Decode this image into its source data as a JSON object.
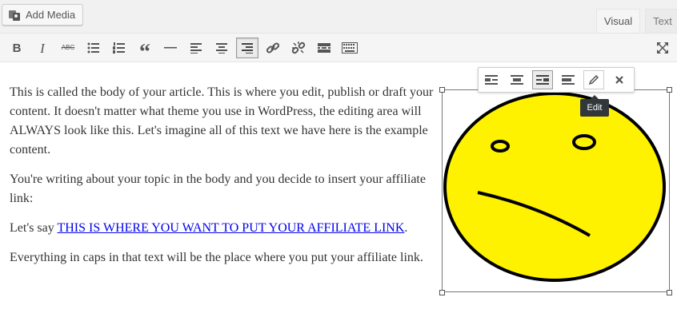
{
  "header": {
    "add_media_label": "Add Media",
    "tabs": [
      {
        "label": "Visual",
        "active": true
      },
      {
        "label": "Text",
        "active": false
      }
    ]
  },
  "toolbar": {
    "buttons": [
      {
        "name": "bold",
        "glyph": "B"
      },
      {
        "name": "italic",
        "glyph": "I"
      },
      {
        "name": "strikethrough",
        "glyph": "ABC"
      },
      {
        "name": "bulleted-list",
        "glyph": ""
      },
      {
        "name": "numbered-list",
        "glyph": ""
      },
      {
        "name": "blockquote",
        "glyph": "“"
      },
      {
        "name": "horizontal-line",
        "glyph": "—"
      },
      {
        "name": "align-left",
        "glyph": ""
      },
      {
        "name": "align-center",
        "glyph": ""
      },
      {
        "name": "align-right",
        "glyph": "",
        "active": true
      },
      {
        "name": "insert-link",
        "glyph": ""
      },
      {
        "name": "remove-link",
        "glyph": ""
      },
      {
        "name": "read-more",
        "glyph": ""
      },
      {
        "name": "toolbar-toggle",
        "glyph": ""
      },
      {
        "name": "fullscreen",
        "glyph": ""
      }
    ]
  },
  "content": {
    "paragraph1": "This is called the body of your article. This is where you edit, publish or draft your content. It doesn't matter what theme you use in WordPress, the editing area will ALWAYS look like this. Let's imagine all of this text we have here is the example content.",
    "paragraph2": "You're writing about your topic in the body and you decide to insert your affiliate link:",
    "paragraph3_prefix": "Let's say ",
    "paragraph3_link": "THIS IS WHERE YOU WANT TO PUT YOUR AFFILIATE LINK",
    "paragraph3_suffix": ".",
    "paragraph4": "Everything in caps in that text will be the place where you put your affiliate link."
  },
  "image_toolbar": {
    "buttons": [
      "align-left",
      "align-center",
      "align-right",
      "align-none",
      "edit",
      "remove"
    ],
    "active": "align-right",
    "tooltip": "Edit"
  },
  "colors": {
    "face_fill": "#fff200",
    "face_stroke": "#000000",
    "link": "#0000ee"
  }
}
